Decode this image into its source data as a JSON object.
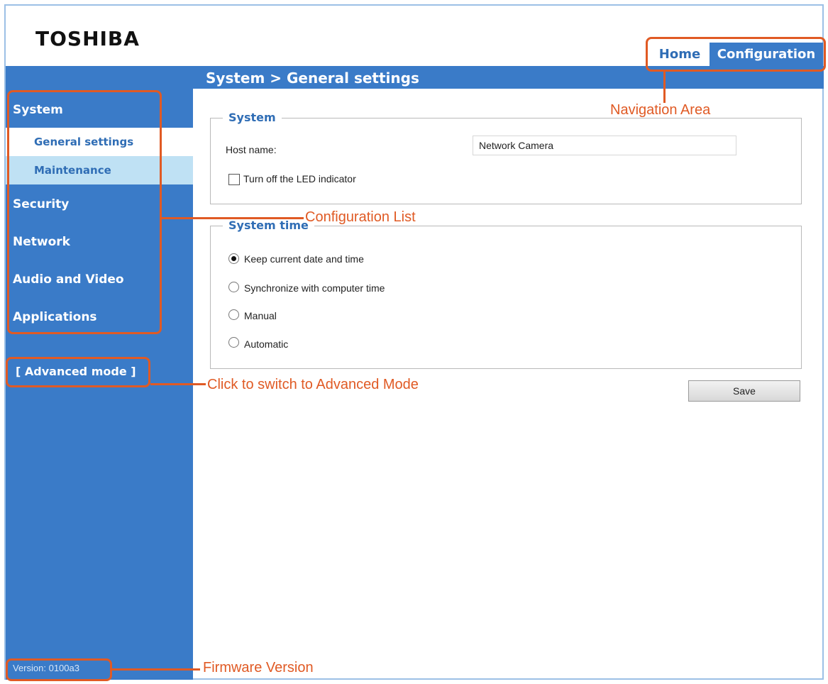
{
  "header": {
    "logo_text": "TOSHIBA"
  },
  "nav": {
    "home_label": "Home",
    "config_label": "Configuration"
  },
  "breadcrumb": "System  > General settings",
  "sidebar": {
    "items": [
      {
        "label": "System"
      },
      {
        "label": "General settings"
      },
      {
        "label": "Maintenance"
      },
      {
        "label": "Security"
      },
      {
        "label": "Network"
      },
      {
        "label": "Audio and Video"
      },
      {
        "label": "Applications"
      }
    ],
    "advanced_mode": "[ Advanced mode ]",
    "version": "Version: 0100a3"
  },
  "system_section": {
    "legend": "System",
    "host_name_label": "Host name:",
    "host_name_value": "Network Camera",
    "led_label": "Turn off the LED indicator"
  },
  "time_section": {
    "legend": "System time",
    "options": [
      {
        "label": "Keep current date and time",
        "checked": true
      },
      {
        "label": "Synchronize with computer time",
        "checked": false
      },
      {
        "label": "Manual",
        "checked": false
      },
      {
        "label": "Automatic",
        "checked": false
      }
    ]
  },
  "save_label": "Save",
  "annotations": {
    "navigation_area": "Navigation Area",
    "configuration_list": "Configuration List",
    "advanced_mode": "Click to switch to Advanced Mode",
    "firmware_version": "Firmware Version"
  },
  "colors": {
    "accent_blue": "#3a7bc8",
    "annotation_orange": "#e05a24",
    "submenu_selected": "#ffffff",
    "submenu_light": "#bfe1f4"
  }
}
